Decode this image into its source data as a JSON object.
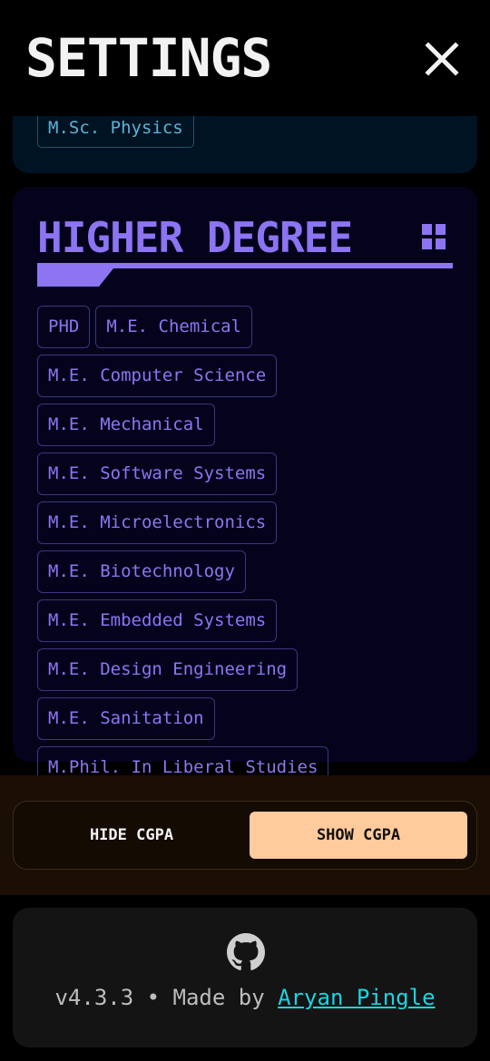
{
  "header": {
    "title": "SETTINGS",
    "close_icon": "close-x-icon"
  },
  "previous_section": {
    "visible_chip": "M.Sc. Physics"
  },
  "higher_degree": {
    "title": "HIGHER DEGREE",
    "icon": "grid-icon",
    "chips": [
      "PHD",
      "M.E. Chemical",
      "M.E. Computer Science",
      "M.E. Mechanical",
      "M.E. Software Systems",
      "M.E. Microelectronics",
      "M.E. Biotechnology",
      "M.E. Embedded Systems",
      "M.E. Design Engineering",
      "M.E. Sanitation",
      "M.Phil. In Liberal Studies"
    ]
  },
  "cgpa_toggle": {
    "hide_label": "HIDE CGPA",
    "show_label": "SHOW CGPA",
    "selected": "SHOW CGPA"
  },
  "footer": {
    "icon": "github-icon",
    "version": "v4.3.3",
    "separator": "•",
    "made_by": "Made by",
    "author": "Aryan Pingle"
  },
  "colors": {
    "accent_purple": "#8c74f3",
    "link_cyan": "#18d6e2",
    "toggle_active": "#ffca9c"
  }
}
